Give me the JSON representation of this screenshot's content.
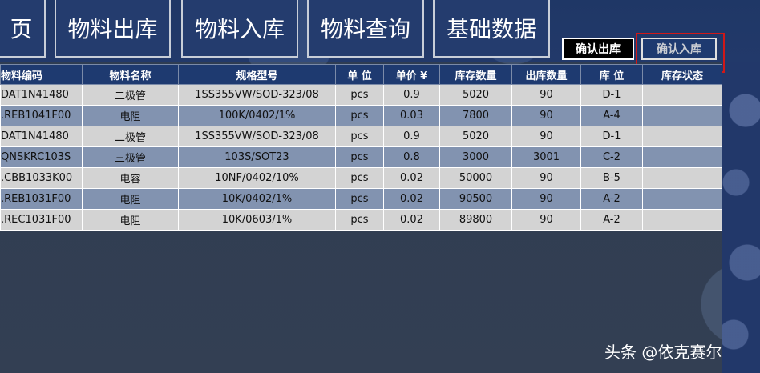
{
  "nav": [
    {
      "label": "页"
    },
    {
      "label": "物料出库"
    },
    {
      "label": "物料入库"
    },
    {
      "label": "物料查询"
    },
    {
      "label": "基础数据"
    }
  ],
  "actions": {
    "confirm_out": "确认出库",
    "confirm_in": "确认入库"
  },
  "table": {
    "headers": [
      "物料编码",
      "物料名称",
      "规格型号",
      "单 位",
      "单价 ¥",
      "库存数量",
      "出库数量",
      "库 位",
      "库存状态"
    ],
    "rows": [
      [
        "DAT1N41480",
        "二极管",
        "1SS355VW/SOD-323/08",
        "pcs",
        "0.9",
        "5020",
        "90",
        "D-1",
        ""
      ],
      [
        ".REB1041F00",
        "电阻",
        "100K/0402/1%",
        "pcs",
        "0.03",
        "7800",
        "90",
        "A-4",
        ""
      ],
      [
        "DAT1N41480",
        "二极管",
        "1SS355VW/SOD-323/08",
        "pcs",
        "0.9",
        "5020",
        "90",
        "D-1",
        ""
      ],
      [
        "QNSKRC103S",
        "三极管",
        "103S/SOT23",
        "pcs",
        "0.8",
        "3000",
        "3001",
        "C-2",
        ""
      ],
      [
        ".CBB1033K00",
        "电容",
        "10NF/0402/10%",
        "pcs",
        "0.02",
        "50000",
        "90",
        "B-5",
        ""
      ],
      [
        ".REB1031F00",
        "电阻",
        "10K/0402/1%",
        "pcs",
        "0.02",
        "90500",
        "90",
        "A-2",
        ""
      ],
      [
        ".REC1031F00",
        "电阻",
        "10K/0603/1%",
        "pcs",
        "0.02",
        "89800",
        "90",
        "A-2",
        ""
      ]
    ]
  },
  "watermark": "头条 @依克赛尔",
  "colors": {
    "header_bg": "#1e3a70",
    "row_light": "#d3d3d3",
    "row_dark": "#8293b0",
    "highlight": "#d01818"
  }
}
